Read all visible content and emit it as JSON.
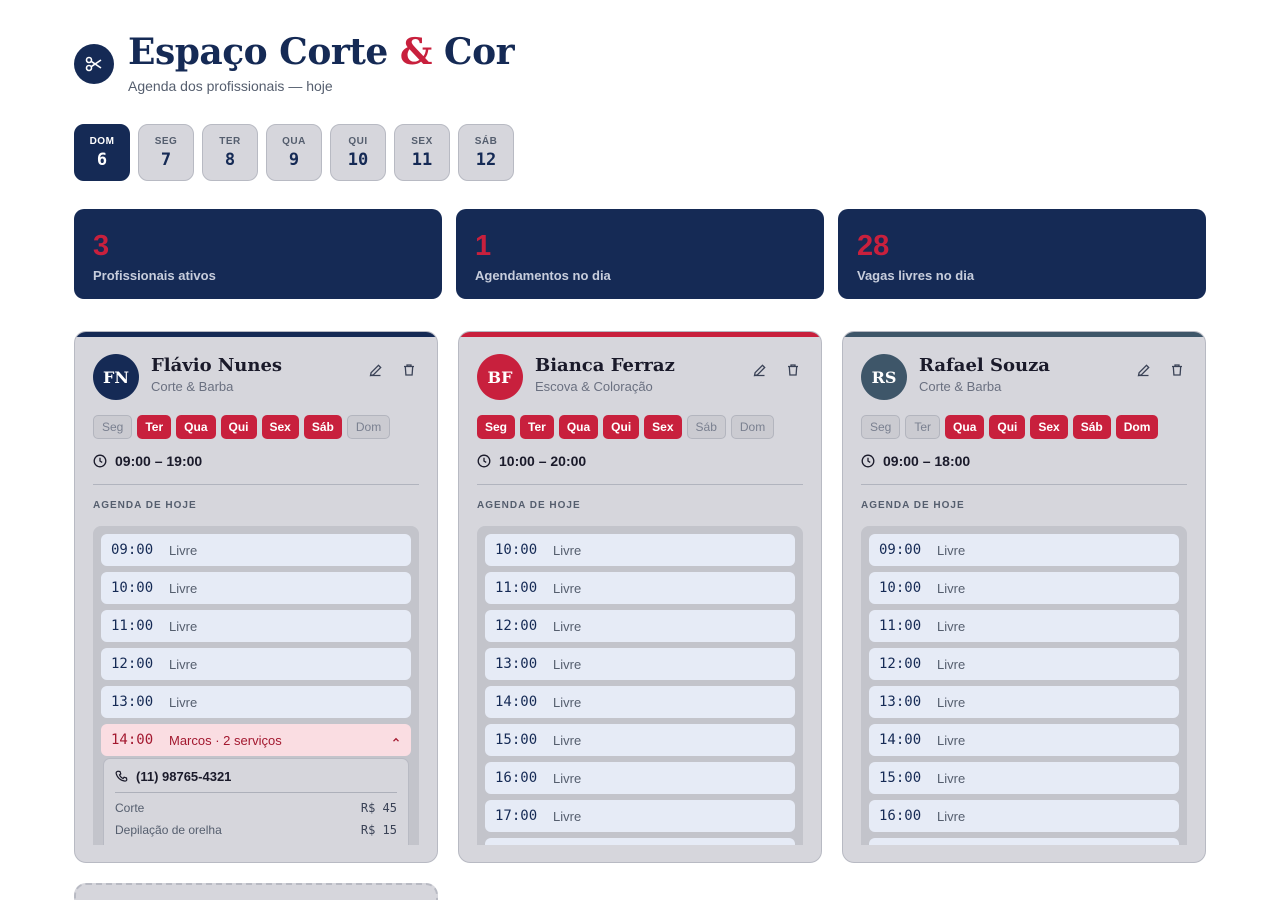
{
  "brand": {
    "title_part1": "Espaço Corte ",
    "title_amp": "&",
    "title_part2": " Cor",
    "subtitle": "Agenda dos profissionais — hoje",
    "logo_icon": "scissors-icon"
  },
  "days": [
    {
      "name": "DOM",
      "num": "6",
      "active": true
    },
    {
      "name": "SEG",
      "num": "7"
    },
    {
      "name": "TER",
      "num": "8"
    },
    {
      "name": "QUA",
      "num": "9"
    },
    {
      "name": "QUI",
      "num": "10"
    },
    {
      "name": "SEX",
      "num": "11"
    },
    {
      "name": "SÁB",
      "num": "12"
    }
  ],
  "stats": [
    {
      "value": "3",
      "label": "Profissionais ativos"
    },
    {
      "value": "1",
      "label": "Agendamentos no dia"
    },
    {
      "value": "28",
      "label": "Vagas livres no dia"
    }
  ],
  "colors": {
    "navy": "#152a55",
    "crimson": "#c8203d",
    "slate": "#3e5669"
  },
  "agenda_label": "AGENDA DE HOJE",
  "professionals": [
    {
      "initials": "FN",
      "name": "Flávio Nunes",
      "specialty": "Corte & Barba",
      "accent": "#152a55",
      "weekdays": [
        {
          "label": "Seg",
          "on": false
        },
        {
          "label": "Ter",
          "on": true
        },
        {
          "label": "Qua",
          "on": true
        },
        {
          "label": "Qui",
          "on": true
        },
        {
          "label": "Sex",
          "on": true
        },
        {
          "label": "Sáb",
          "on": true
        },
        {
          "label": "Dom",
          "on": false
        }
      ],
      "hours": "09:00 – 19:00",
      "slots": [
        {
          "time": "09:00",
          "desc": "Livre"
        },
        {
          "time": "10:00",
          "desc": "Livre"
        },
        {
          "time": "11:00",
          "desc": "Livre"
        },
        {
          "time": "12:00",
          "desc": "Livre"
        },
        {
          "time": "13:00",
          "desc": "Livre"
        },
        {
          "time": "14:00",
          "desc": "Marcos · 2 serviços",
          "booked": true
        }
      ],
      "booking_detail": {
        "phone": "(11) 98765-4321",
        "services": [
          {
            "name": "Corte",
            "price": "R$ 45"
          },
          {
            "name": "Depilação de orelha",
            "price": "R$ 15"
          }
        ]
      }
    },
    {
      "initials": "BF",
      "name": "Bianca Ferraz",
      "specialty": "Escova & Coloração",
      "accent": "#c8203d",
      "weekdays": [
        {
          "label": "Seg",
          "on": true
        },
        {
          "label": "Ter",
          "on": true
        },
        {
          "label": "Qua",
          "on": true
        },
        {
          "label": "Qui",
          "on": true
        },
        {
          "label": "Sex",
          "on": true
        },
        {
          "label": "Sáb",
          "on": false
        },
        {
          "label": "Dom",
          "on": false
        }
      ],
      "hours": "10:00 – 20:00",
      "slots": [
        {
          "time": "10:00",
          "desc": "Livre"
        },
        {
          "time": "11:00",
          "desc": "Livre"
        },
        {
          "time": "12:00",
          "desc": "Livre"
        },
        {
          "time": "13:00",
          "desc": "Livre"
        },
        {
          "time": "14:00",
          "desc": "Livre"
        },
        {
          "time": "15:00",
          "desc": "Livre"
        },
        {
          "time": "16:00",
          "desc": "Livre"
        },
        {
          "time": "17:00",
          "desc": "Livre"
        }
      ]
    },
    {
      "initials": "RS",
      "name": "Rafael Souza",
      "specialty": "Corte & Barba",
      "accent": "#3e5669",
      "weekdays": [
        {
          "label": "Seg",
          "on": false
        },
        {
          "label": "Ter",
          "on": false
        },
        {
          "label": "Qua",
          "on": true
        },
        {
          "label": "Qui",
          "on": true
        },
        {
          "label": "Sex",
          "on": true
        },
        {
          "label": "Sáb",
          "on": true
        },
        {
          "label": "Dom",
          "on": true
        }
      ],
      "hours": "09:00 – 18:00",
      "slots": [
        {
          "time": "09:00",
          "desc": "Livre"
        },
        {
          "time": "10:00",
          "desc": "Livre"
        },
        {
          "time": "11:00",
          "desc": "Livre"
        },
        {
          "time": "12:00",
          "desc": "Livre"
        },
        {
          "time": "13:00",
          "desc": "Livre"
        },
        {
          "time": "14:00",
          "desc": "Livre"
        },
        {
          "time": "15:00",
          "desc": "Livre"
        },
        {
          "time": "16:00",
          "desc": "Livre"
        }
      ]
    }
  ]
}
